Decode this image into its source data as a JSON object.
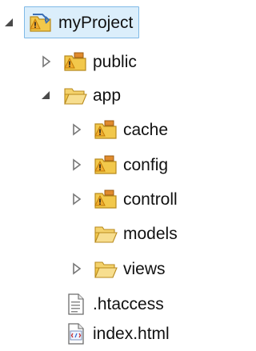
{
  "tree": {
    "root": {
      "label": "myProject",
      "state": "expanded",
      "icon": "project-warning-icon"
    },
    "items": [
      {
        "label": "public",
        "state": "collapsed",
        "icon": "package-folder-warning-icon"
      },
      {
        "label": "app",
        "state": "expanded",
        "icon": "open-folder-icon"
      },
      {
        "label": "cache",
        "state": "collapsed",
        "icon": "package-folder-warning-icon"
      },
      {
        "label": "config",
        "state": "collapsed",
        "icon": "package-folder-warning-icon"
      },
      {
        "label": "controll",
        "state": "collapsed",
        "icon": "package-folder-warning-icon"
      },
      {
        "label": "models",
        "state": "none",
        "icon": "folder-icon"
      },
      {
        "label": "views",
        "state": "collapsed",
        "icon": "folder-icon"
      },
      {
        "label": ".htaccess",
        "state": "none",
        "icon": "text-file-icon"
      },
      {
        "label": "index.html",
        "state": "none",
        "icon": "html-file-icon"
      }
    ]
  },
  "colors": {
    "selection_bg": "#dbeefb",
    "selection_border": "#7fb9e6",
    "folder": "#f2c84b",
    "warning": "#e6a23c"
  }
}
